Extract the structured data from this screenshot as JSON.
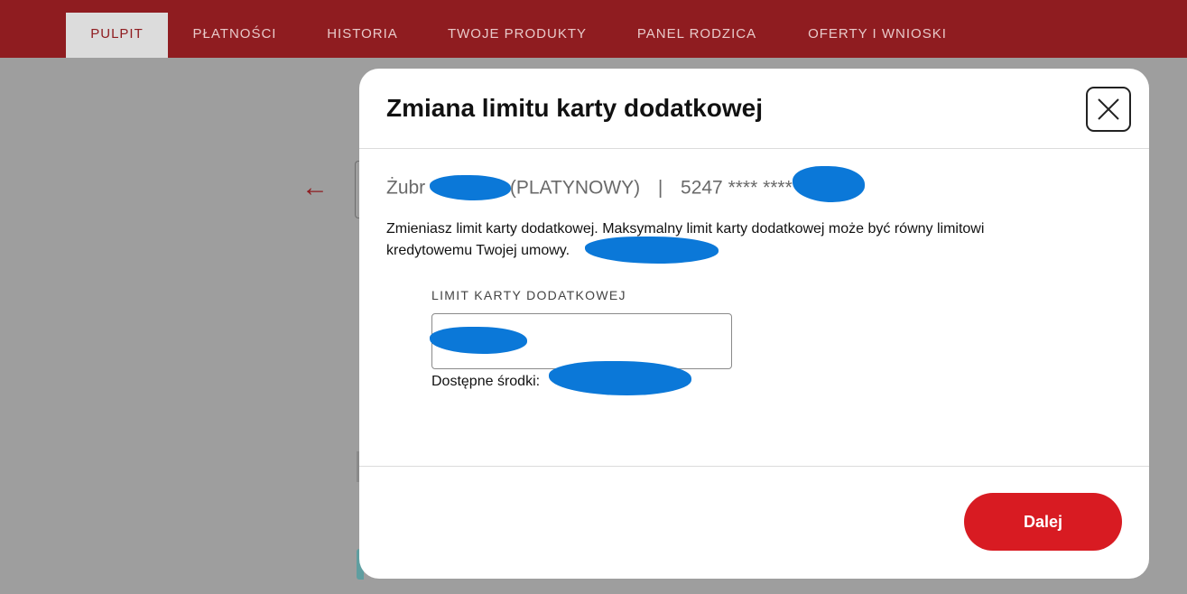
{
  "nav": {
    "tabs": [
      {
        "label": "PULPIT",
        "active": true
      },
      {
        "label": "PŁATNOŚCI",
        "active": false
      },
      {
        "label": "HISTORIA",
        "active": false
      },
      {
        "label": "TWOJE PRODUKTY",
        "active": false
      },
      {
        "label": "PANEL RODZICA",
        "active": false
      },
      {
        "label": "OFERTY I WNIOSKI",
        "active": false
      }
    ]
  },
  "background": {
    "back_arrow": "←"
  },
  "modal": {
    "title": "Zmiana limitu karty dodatkowej",
    "card": {
      "name_prefix": "Żubr",
      "type": "(PLATYNOWY)",
      "separator": "|",
      "number_prefix": "5247 **** ****"
    },
    "description": "Zmieniasz limit karty dodatkowej. Maksymalny limit karty dodatkowej może być równy limitowi kredytowemu Twojej umowy.",
    "limit_field": {
      "label": "LIMIT KARTY DODATKOWEJ",
      "value": ""
    },
    "available_funds_label": "Dostępne środki:",
    "next_button": "Dalej"
  },
  "colors": {
    "brand_red": "#8f1c20",
    "button_red": "#d81b22",
    "redaction_blue": "#0b78d8"
  },
  "icons": {
    "close": "close-icon",
    "back": "arrow-left-icon"
  }
}
